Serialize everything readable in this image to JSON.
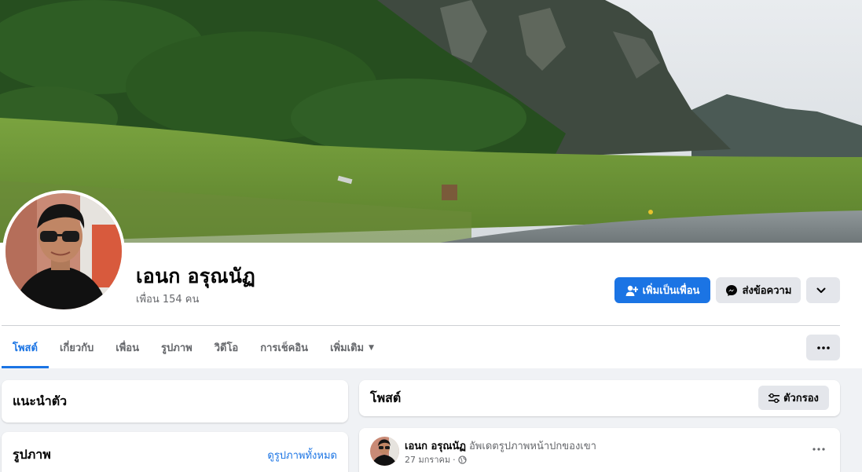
{
  "profile": {
    "name": "เอนก อรุณนัฏ",
    "friends_count": "เพื่อน 154 คน"
  },
  "actions": {
    "add_friend_label": "เพิ่มเป็นเพื่อน",
    "message_label": "ส่งข้อความ"
  },
  "tabs": [
    {
      "label": "โพสต์",
      "active": true
    },
    {
      "label": "เกี่ยวกับ"
    },
    {
      "label": "เพื่อน"
    },
    {
      "label": "รูปภาพ"
    },
    {
      "label": "วิดีโอ"
    },
    {
      "label": "การเช็คอิน"
    },
    {
      "label": "เพิ่มเติม"
    }
  ],
  "intro": {
    "title": "แนะนำตัว"
  },
  "photos": {
    "title": "รูปภาพ",
    "see_all_label": "ดูรูปภาพทั้งหมด"
  },
  "posts": {
    "title": "โพสต์",
    "filter_label": "ตัวกรอง"
  },
  "post": {
    "author": "เอนก อรุณนัฏ",
    "action": "อัพเดตรูปภาพหน้าปกของเขา",
    "date": "27 มกราคม",
    "separator": "·"
  },
  "colors": {
    "accent": "#1b74e4",
    "secondary_button": "#e4e6eb",
    "background": "#f0f2f5",
    "muted_text": "#65676b"
  },
  "icons": {
    "add_friend": "person-plus-icon",
    "message": "messenger-icon",
    "more": "chevron-down-icon",
    "options": "ellipsis-icon",
    "filter": "sliders-icon",
    "privacy": "globe-icon"
  }
}
